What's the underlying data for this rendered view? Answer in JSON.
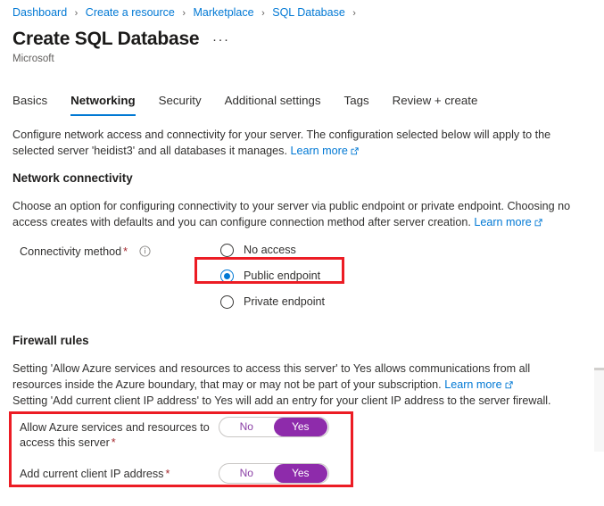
{
  "breadcrumb": {
    "separator": "›",
    "items": [
      {
        "label": "Dashboard"
      },
      {
        "label": "Create a resource"
      },
      {
        "label": "Marketplace"
      },
      {
        "label": "SQL Database"
      }
    ]
  },
  "header": {
    "title": "Create SQL Database",
    "ellipsis": "···",
    "publisher": "Microsoft"
  },
  "tabs": [
    {
      "label": "Basics",
      "active": false
    },
    {
      "label": "Networking",
      "active": true
    },
    {
      "label": "Security",
      "active": false
    },
    {
      "label": "Additional settings",
      "active": false
    },
    {
      "label": "Tags",
      "active": false
    },
    {
      "label": "Review + create",
      "active": false
    }
  ],
  "intro": {
    "text": "Configure network access and connectivity for your server. The configuration selected below will apply to the selected server 'heidist3' and all databases it manages.",
    "link": "Learn more"
  },
  "network_connectivity": {
    "heading": "Network connectivity",
    "description": "Choose an option for configuring connectivity to your server via public endpoint or private endpoint. Choosing no access creates with defaults and you can configure connection method after server creation.",
    "link": "Learn more",
    "field": {
      "label": "Connectivity method",
      "required_marker": "*",
      "info_icon": "info-icon",
      "options": [
        {
          "label": "No access",
          "selected": false
        },
        {
          "label": "Public endpoint",
          "selected": true
        },
        {
          "label": "Private endpoint",
          "selected": false
        }
      ]
    }
  },
  "firewall_rules": {
    "heading": "Firewall rules",
    "description_line1": "Setting 'Allow Azure services and resources to access this server' to Yes allows communications from all resources inside the Azure boundary, that may or may not be part of your subscription.",
    "link": "Learn more",
    "description_line2": "Setting 'Add current client IP address' to Yes will add an entry for your client IP address to the server firewall.",
    "toggles": [
      {
        "label": "Allow Azure services and resources to access this server",
        "required_marker": "*",
        "off_label": "No",
        "on_label": "Yes",
        "value": "Yes"
      },
      {
        "label": "Add current client IP address",
        "required_marker": "*",
        "off_label": "No",
        "on_label": "Yes",
        "value": "Yes"
      }
    ]
  },
  "colors": {
    "accent_blue": "#0078d4",
    "toggle_purple": "#8e2bab",
    "highlight_red": "#ec1c24",
    "required_red": "#a4262c"
  }
}
